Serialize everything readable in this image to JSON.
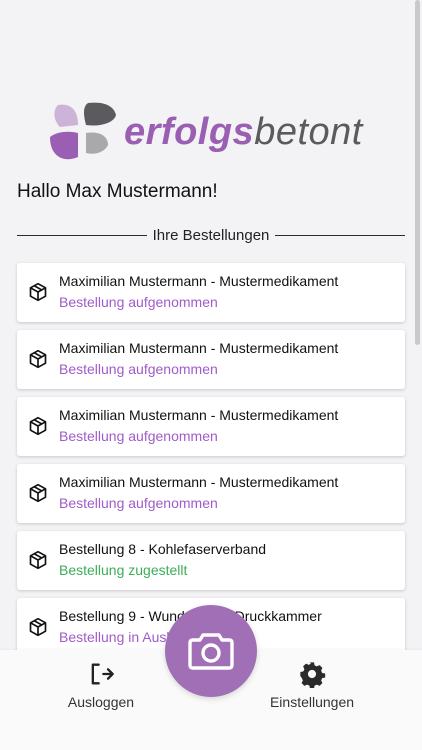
{
  "brand": {
    "name_bold": "erfolgs",
    "name_light": "betont",
    "colors": {
      "purple": "#9a5fb3",
      "grey": "#5b5b5f"
    }
  },
  "greeting": "Hallo Max Mustermann!",
  "orders_section": {
    "label": "Ihre Bestellungen",
    "items": [
      {
        "title": "Maximilian Mustermann - Mustermedikament",
        "status": "Bestellung aufgenommen",
        "status_color": "#a05cc8",
        "icon": "package-icon"
      },
      {
        "title": "Maximilian Mustermann - Mustermedikament",
        "status": "Bestellung aufgenommen",
        "status_color": "#a05cc8",
        "icon": "package-icon"
      },
      {
        "title": "Maximilian Mustermann - Mustermedikament",
        "status": "Bestellung aufgenommen",
        "status_color": "#a05cc8",
        "icon": "package-icon"
      },
      {
        "title": "Maximilian Mustermann - Mustermedikament",
        "status": "Bestellung aufgenommen",
        "status_color": "#a05cc8",
        "icon": "package-icon"
      },
      {
        "title": "Bestellung 8 - Kohlefaserverband",
        "status": "Bestellung zugestellt",
        "status_color": "#3dad5a",
        "icon": "package-icon"
      },
      {
        "title": "Bestellung 9 - Wundauflage Druckkammer",
        "status": "Bestellung in Auslieferung",
        "status_color": "#a05cc8",
        "icon": "package-icon"
      }
    ]
  },
  "bottom_nav": {
    "logout_label": "Ausloggen",
    "logout_icon": "logout-icon",
    "settings_label": "Einstellungen",
    "settings_icon": "gear-icon",
    "camera_icon": "camera-icon",
    "camera_color": "#a06fb5"
  }
}
